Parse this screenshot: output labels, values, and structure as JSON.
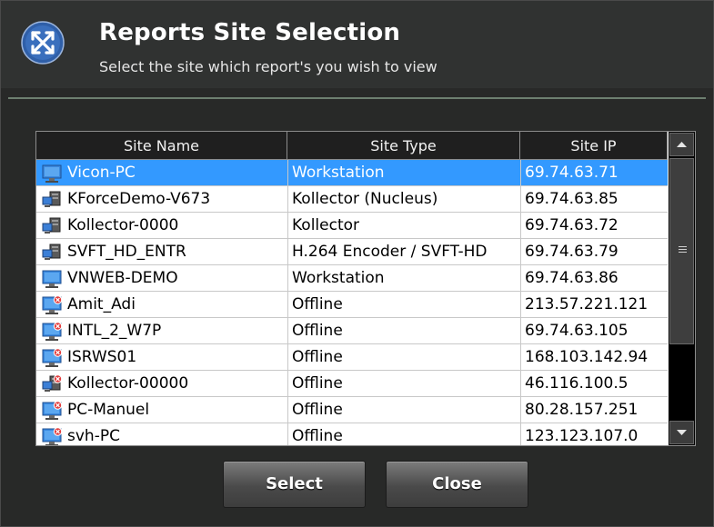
{
  "dialog": {
    "title": "Reports Site Selection",
    "subtitle": "Select the site which report's you wish to view",
    "logo_icon": "crossed-arrows-logo-icon"
  },
  "table": {
    "columns": [
      "Site Name",
      "Site Type",
      "Site IP"
    ],
    "selected_index": 0,
    "rows": [
      {
        "name": "Vicon-PC",
        "type": "Workstation",
        "ip": "69.74.63.71",
        "icon": "workstation-icon"
      },
      {
        "name": "KForceDemo-V673",
        "type": "Kollector (Nucleus)",
        "ip": "69.74.63.85",
        "icon": "server-icon"
      },
      {
        "name": "Kollector-0000",
        "type": "Kollector",
        "ip": "69.74.63.72",
        "icon": "server-icon"
      },
      {
        "name": "SVFT_HD_ENTR",
        "type": "H.264 Encoder / SVFT-HD",
        "ip": "69.74.63.79",
        "icon": "server-icon"
      },
      {
        "name": "VNWEB-DEMO",
        "type": "Workstation",
        "ip": "69.74.63.86",
        "icon": "workstation-icon"
      },
      {
        "name": "Amit_Adi",
        "type": "Offline",
        "ip": "213.57.221.121",
        "icon": "workstation-offline-icon"
      },
      {
        "name": "INTL_2_W7P",
        "type": "Offline",
        "ip": "69.74.63.105",
        "icon": "workstation-offline-icon"
      },
      {
        "name": "ISRWS01",
        "type": "Offline",
        "ip": "168.103.142.94",
        "icon": "workstation-offline-icon"
      },
      {
        "name": "Kollector-00000",
        "type": "Offline",
        "ip": "46.116.100.5",
        "icon": "server-offline-icon"
      },
      {
        "name": "PC-Manuel",
        "type": "Offline",
        "ip": "80.28.157.251",
        "icon": "workstation-offline-icon"
      },
      {
        "name": "svh-PC",
        "type": "Offline",
        "ip": "123.123.107.0",
        "icon": "workstation-offline-icon"
      }
    ]
  },
  "buttons": {
    "select_label": "Select",
    "close_label": "Close"
  },
  "colors": {
    "background": "#282928",
    "selection": "#3399ff",
    "separator": "#6d7f70"
  }
}
